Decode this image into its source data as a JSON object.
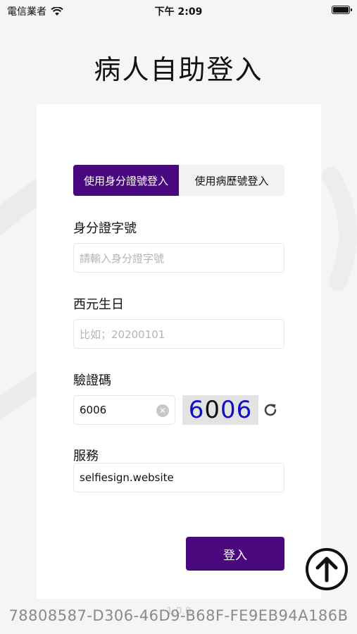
{
  "status_bar": {
    "carrier": "電信業者",
    "time": "下午 2:09"
  },
  "title": "病人自助登入",
  "tabs": [
    {
      "label": "使用身分證號登入",
      "active": true
    },
    {
      "label": "使用病歷號登入",
      "active": false
    }
  ],
  "id_field": {
    "label": "身分證字號",
    "placeholder": "請輸入身分證字號",
    "value": ""
  },
  "dob_field": {
    "label": "西元生日",
    "placeholder": "比如；20200101",
    "value": ""
  },
  "captcha": {
    "label": "驗證碼",
    "value": "6006",
    "image_text": "6006"
  },
  "service": {
    "label": "服務",
    "value": "selfiesign.website"
  },
  "login_button": "登入",
  "version": "1.0.0",
  "device_id": "78808587-D306-46D9-B68F-FE9EB94A186B",
  "colors": {
    "accent": "#4a087f",
    "card": "#ffffff",
    "background": "#f5f5f5"
  },
  "icons": [
    "wifi-icon",
    "battery-icon",
    "clear-icon",
    "refresh-icon",
    "arrow-up-icon"
  ]
}
